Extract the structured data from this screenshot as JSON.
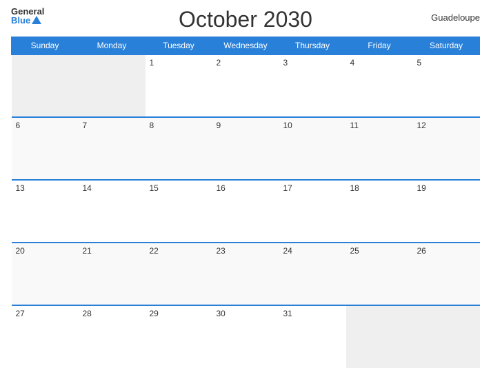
{
  "header": {
    "title": "October 2030",
    "region": "Guadeloupe",
    "logo_general": "General",
    "logo_blue": "Blue"
  },
  "days": [
    "Sunday",
    "Monday",
    "Tuesday",
    "Wednesday",
    "Thursday",
    "Friday",
    "Saturday"
  ],
  "weeks": [
    [
      "",
      "",
      "1",
      "2",
      "3",
      "4",
      "5"
    ],
    [
      "6",
      "7",
      "8",
      "9",
      "10",
      "11",
      "12"
    ],
    [
      "13",
      "14",
      "15",
      "16",
      "17",
      "18",
      "19"
    ],
    [
      "20",
      "21",
      "22",
      "23",
      "24",
      "25",
      "26"
    ],
    [
      "27",
      "28",
      "29",
      "30",
      "31",
      "",
      ""
    ]
  ],
  "colors": {
    "accent": "#2980d9"
  }
}
